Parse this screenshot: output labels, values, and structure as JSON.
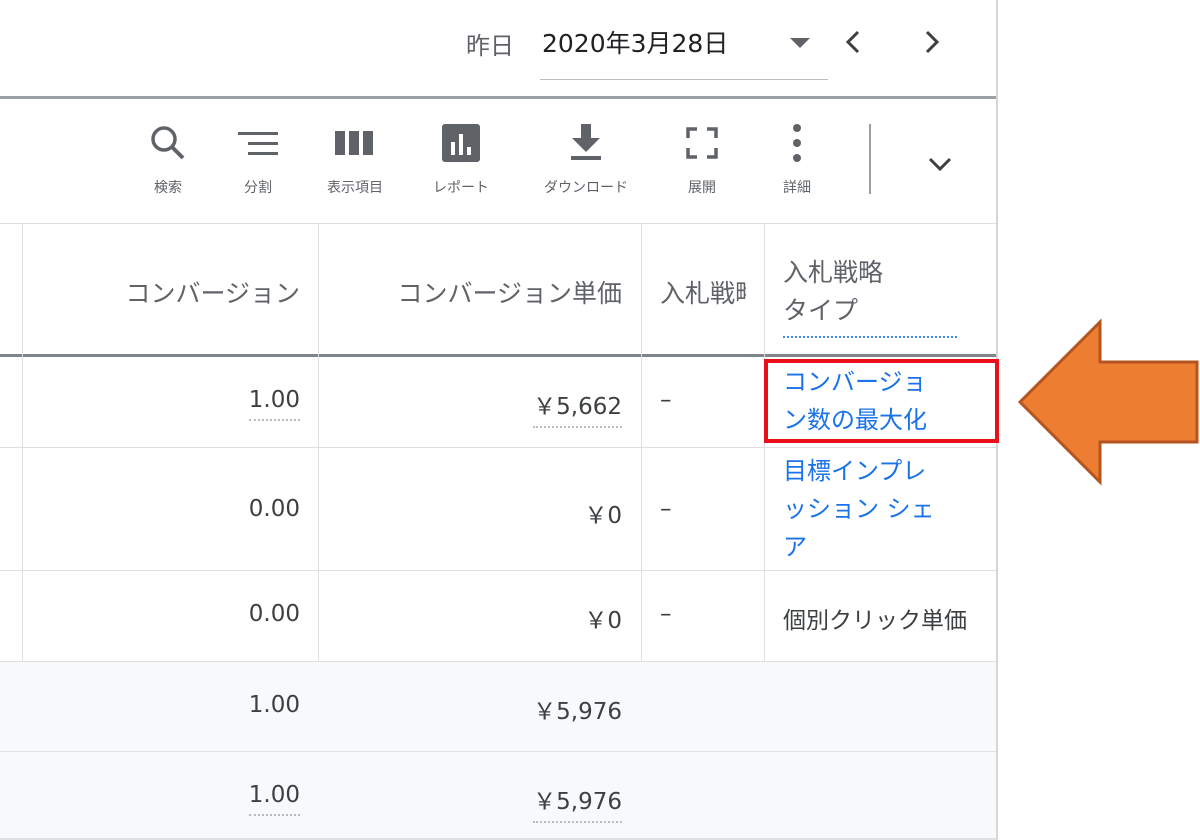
{
  "date": {
    "label": "昨日",
    "value": "2020年3月28日"
  },
  "toolbar": {
    "search": "検索",
    "segment": "分割",
    "columns": "表示項目",
    "report": "レポート",
    "download": "ダウンロード",
    "expand": "展開",
    "details": "詳細"
  },
  "table": {
    "headers": {
      "conversions": "コンバージョン",
      "cost_per_conv": "コンバージョン単価",
      "bid_strategy": "入札戦略",
      "bid_strategy_type_line1": "入札戦略",
      "bid_strategy_type_line2": "タイプ"
    },
    "rows": [
      {
        "conversions": "1.00",
        "cost": "￥5,662",
        "bid": "–",
        "type_line1": "コンバージョ",
        "type_line2": "ン数の最大化",
        "type_line3": ""
      },
      {
        "conversions": "0.00",
        "cost": "￥0",
        "bid": "–",
        "type_line1": "目標インプレ",
        "type_line2": "ッション シェ",
        "type_line3": "ア"
      },
      {
        "conversions": "0.00",
        "cost": "￥0",
        "bid": "–",
        "type_line1": "個別クリック単価",
        "type_line2": "",
        "type_line3": ""
      },
      {
        "conversions": "1.00",
        "cost": "￥5,976"
      },
      {
        "conversions": "1.00",
        "cost": "￥5,976"
      }
    ]
  },
  "colors": {
    "link": "#1a73e8",
    "highlight": "#e8101a",
    "arrow": "#ed7d31",
    "arrow_border": "#b4541e"
  }
}
